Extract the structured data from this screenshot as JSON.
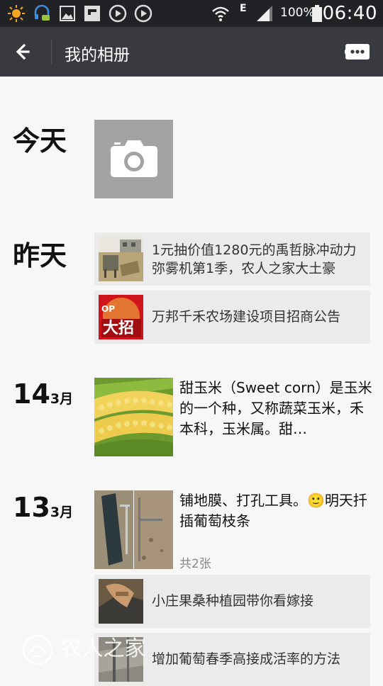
{
  "status_bar": {
    "network_type": "E",
    "battery": "100%",
    "time": "06:40"
  },
  "nav": {
    "title": "我的相册"
  },
  "sections": {
    "today": {
      "label": "今天"
    },
    "yesterday": {
      "label": "昨天",
      "items": [
        {
          "text": "1元抽价值1280元的禹哲脉冲动力弥雾机第1季，农人之家大土豪"
        },
        {
          "text": "万邦千禾农场建设项目招商公告"
        }
      ]
    },
    "mar14": {
      "day": "14",
      "month": "3月",
      "text": "甜玉米（Sweet corn）是玉米的一个种，又称蔬菜玉米，禾本科，玉米属。甜…"
    },
    "mar13": {
      "day": "13",
      "month": "3月",
      "text": "铺地膜、打孔工具。🙂明天扦插葡萄枝条",
      "count": "共2张",
      "items": [
        {
          "text": "小庄果桑种植园带你看嫁接"
        },
        {
          "text": "增加葡萄春季高接成活率的方法"
        }
      ]
    }
  },
  "watermark": {
    "text": "农人之家"
  },
  "thumb_banner_text": "大招",
  "thumb_banner_small": "OP"
}
